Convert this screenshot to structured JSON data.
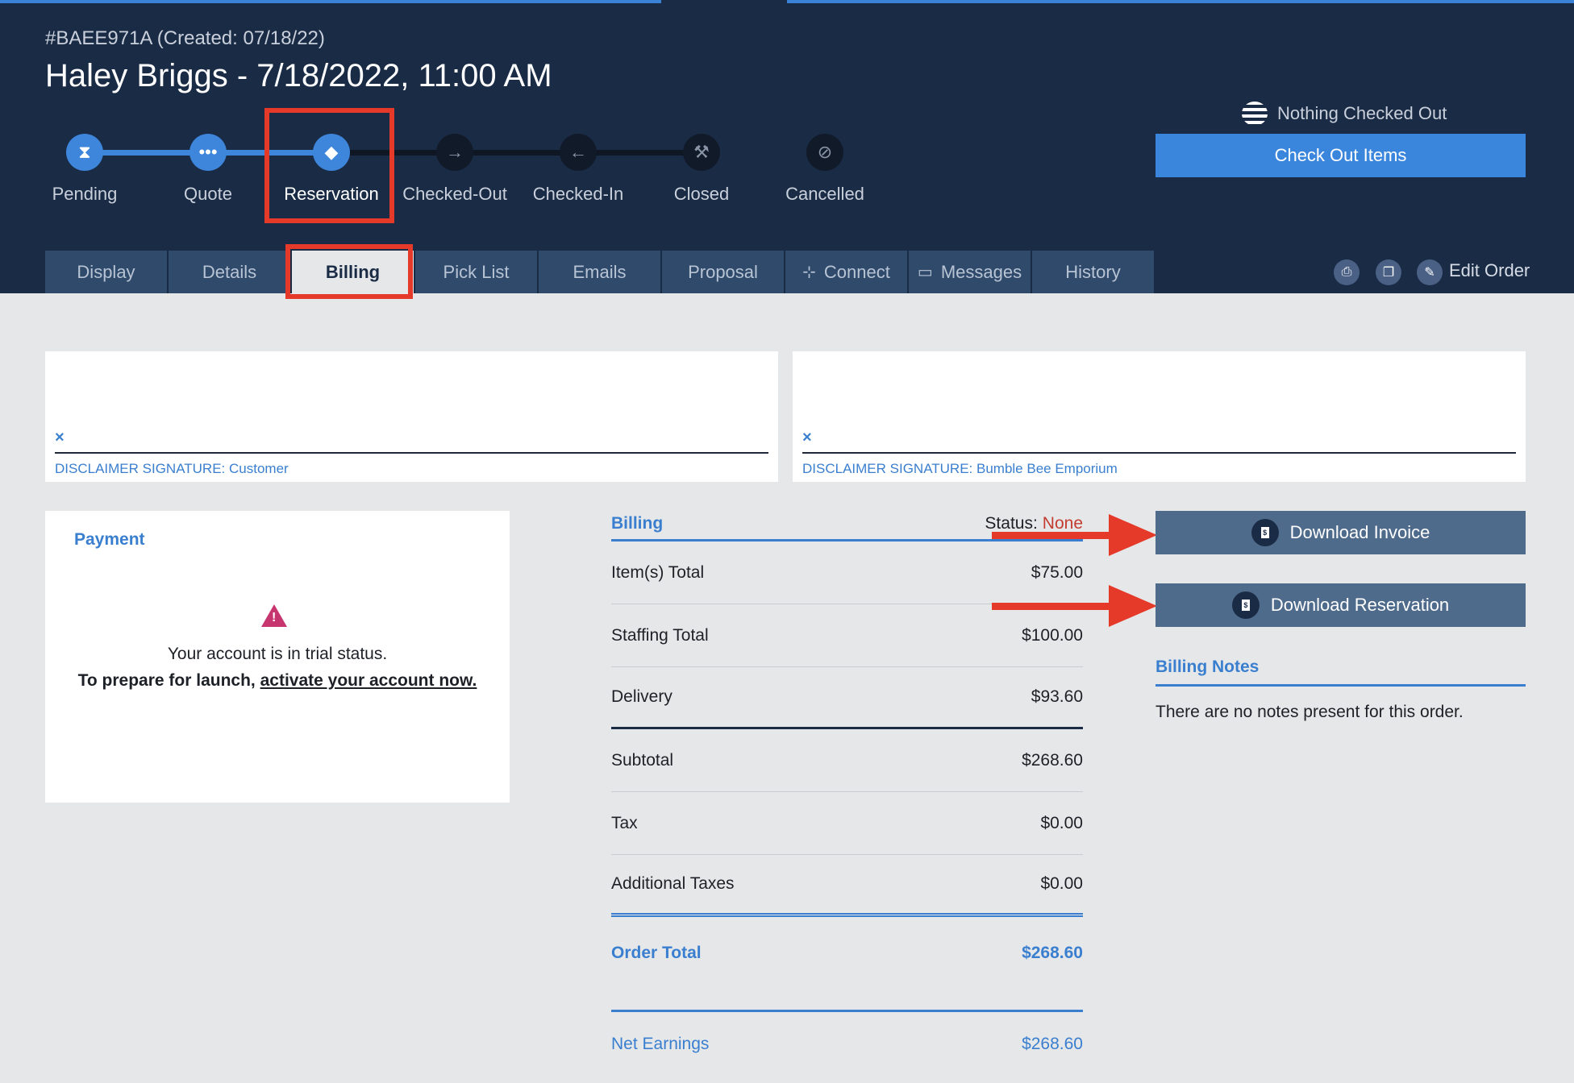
{
  "header": {
    "order_id": "#BAEE971A (Created: 07/18/22)",
    "title": "Haley Briggs - 7/18/2022, 11:00 AM",
    "checked_status": "Nothing Checked Out",
    "checkout_label": "Check Out Items",
    "edit_label": "Edit Order"
  },
  "steps": [
    {
      "label": "Pending",
      "icon": "hourglass-icon"
    },
    {
      "label": "Quote",
      "icon": "ellipsis-icon"
    },
    {
      "label": "Reservation",
      "icon": "tag-icon"
    },
    {
      "label": "Checked-Out",
      "icon": "arrow-right-icon"
    },
    {
      "label": "Checked-In",
      "icon": "arrow-left-icon"
    },
    {
      "label": "Closed",
      "icon": "gavel-icon"
    },
    {
      "label": "Cancelled",
      "icon": "ban-icon"
    }
  ],
  "tabs": [
    {
      "label": "Display"
    },
    {
      "label": "Details"
    },
    {
      "label": "Billing"
    },
    {
      "label": "Pick List"
    },
    {
      "label": "Emails"
    },
    {
      "label": "Proposal"
    },
    {
      "label": "Connect",
      "icon": "network-icon"
    },
    {
      "label": "Messages",
      "icon": "inbox-icon"
    },
    {
      "label": "History"
    }
  ],
  "signatures": [
    {
      "x": "×",
      "label": "DISCLAIMER SIGNATURE: Customer"
    },
    {
      "x": "×",
      "label": "DISCLAIMER SIGNATURE: Bumble Bee Emporium"
    }
  ],
  "payment": {
    "title": "Payment",
    "trial_text": "Your account is in trial status.",
    "launch_prefix": "To prepare for launch, ",
    "launch_link": "activate your account now."
  },
  "billing": {
    "title": "Billing",
    "status_label": "Status:",
    "status_value": "None",
    "rows": [
      {
        "label": "Item(s) Total",
        "value": "$75.00"
      },
      {
        "label": "Staffing Total",
        "value": "$100.00"
      },
      {
        "label": "Delivery",
        "value": "$93.60"
      },
      {
        "label": "Subtotal",
        "value": "$268.60"
      },
      {
        "label": "Tax",
        "value": "$0.00"
      },
      {
        "label": "Additional Taxes",
        "value": "$0.00"
      }
    ],
    "order_total_label": "Order Total",
    "order_total_value": "$268.60",
    "net_label": "Net Earnings",
    "net_value": "$268.60"
  },
  "downloads": {
    "invoice_label": "Download Invoice",
    "reservation_label": "Download Reservation"
  },
  "notes": {
    "title": "Billing Notes",
    "text": "There are no notes present for this order."
  },
  "colors": {
    "header_bg": "#1a2b45",
    "accent": "#3a7fcf",
    "highlight": "#e5392a",
    "status_none": "#c43c2f"
  }
}
